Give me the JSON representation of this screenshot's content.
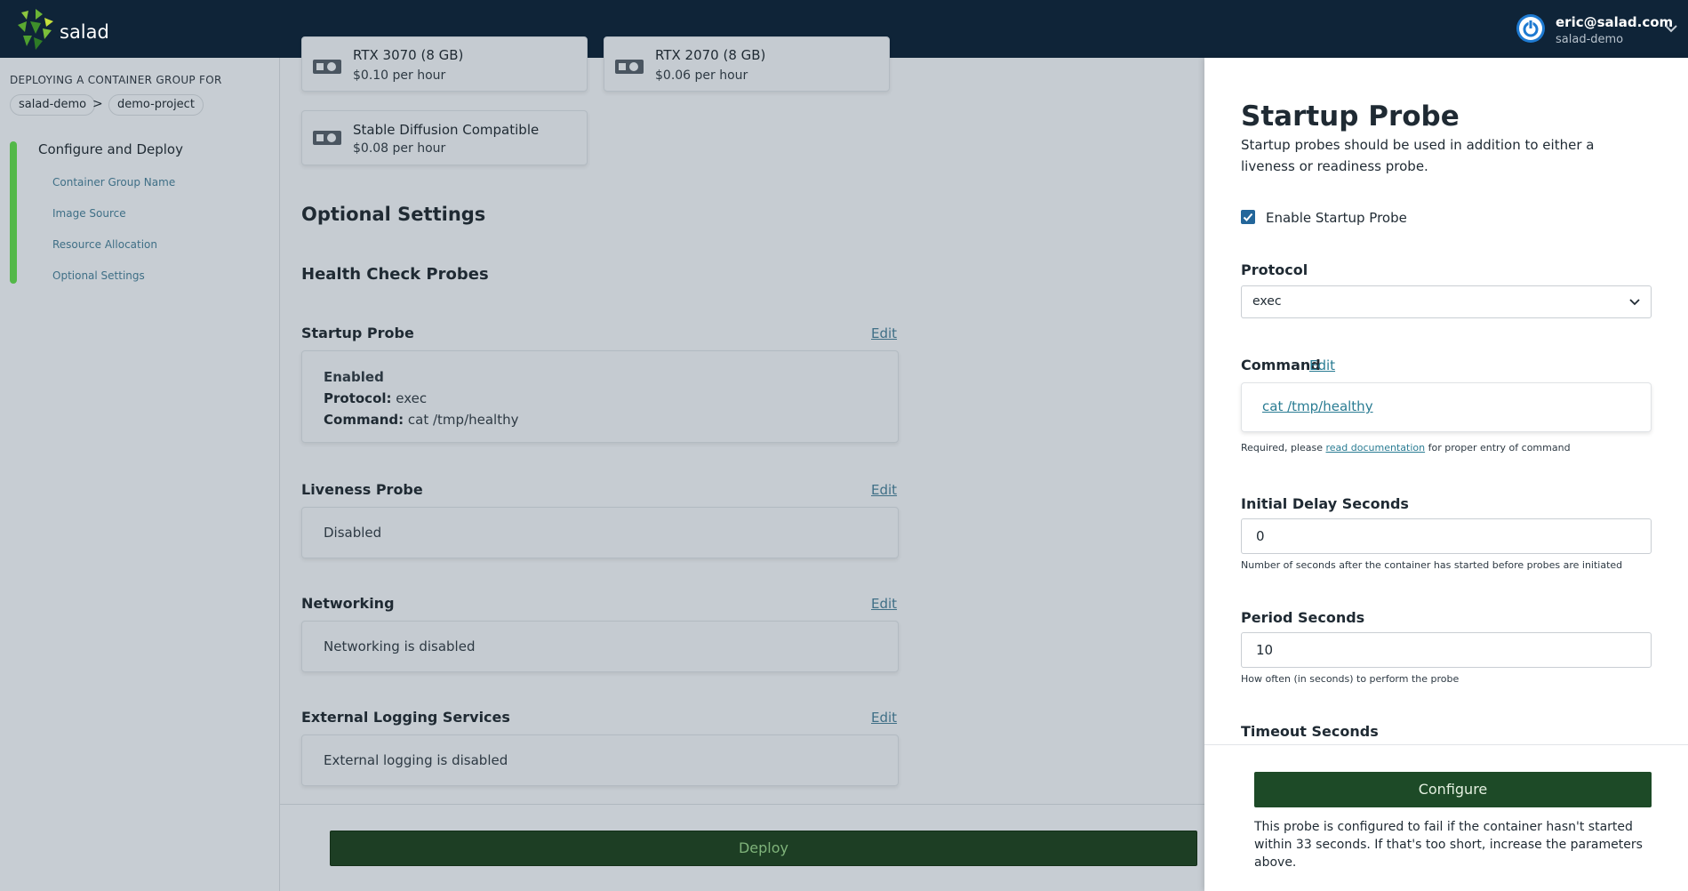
{
  "header": {
    "brand": "salad",
    "user_email": "eric@salad.com",
    "user_org": "salad-demo"
  },
  "sidebar": {
    "deploying_label": "DEPLOYING A CONTAINER GROUP FOR",
    "org_crumb": "salad-demo",
    "crumb_separator": ">",
    "project_crumb": "demo-project",
    "step_title": "Configure and Deploy",
    "steps": [
      "Container Group Name",
      "Image Source",
      "Resource Allocation",
      "Optional Settings"
    ]
  },
  "gpus": [
    {
      "name": "RTX 3070 (8 GB)",
      "price": "$0.10 per hour"
    },
    {
      "name": "RTX 2070 (8 GB)",
      "price": "$0.06 per hour"
    },
    {
      "name": "Stable Diffusion Compatible",
      "price": "$0.08 per hour"
    }
  ],
  "main": {
    "optional_settings": "Optional Settings",
    "health_check_probes": "Health Check Probes",
    "edit_label": "Edit",
    "startup": {
      "title": "Startup Probe",
      "status": "Enabled",
      "protocol_label": "Protocol:",
      "protocol_value": "exec",
      "command_label": "Command:",
      "command_value": "cat /tmp/healthy"
    },
    "liveness": {
      "title": "Liveness Probe",
      "status": "Disabled"
    },
    "networking": {
      "title": "Networking",
      "status": "Networking is disabled"
    },
    "logging": {
      "title": "External Logging Services",
      "status": "External logging is disabled"
    },
    "deploy_label": "Deploy"
  },
  "panel": {
    "title": "Startup Probe",
    "description": "Startup probes should be used in addition to either a liveness or readiness probe.",
    "enable_label": "Enable Startup Probe",
    "enable_checked": true,
    "protocol_label": "Protocol",
    "protocol_value": "exec",
    "command_label": "Command",
    "command_edit": "Edit",
    "command_value": "cat /tmp/healthy",
    "command_help_pre": "Required, please",
    "command_help_link": "read documentation",
    "command_help_post": "for proper entry of command",
    "initial_delay_label": "Initial Delay Seconds",
    "initial_delay_value": "0",
    "initial_delay_help": "Number of seconds after the container has started before probes are initiated",
    "period_label": "Period Seconds",
    "period_value": "10",
    "period_help": "How often (in seconds) to perform the probe",
    "timeout_label": "Timeout Seconds",
    "configure_label": "Configure",
    "footer_note": "This probe is configured to fail if the container hasn't started within 33 seconds. If that's too short, increase the parameters above."
  },
  "colors": {
    "topbar": "#0f2438",
    "accent_green": "#53b848",
    "button_green": "#1d4a27",
    "link": "#2a7c93",
    "checkbox": "#23669a"
  },
  "icons": {
    "logo": "salad-logo-icon",
    "user": "power-icon",
    "caret": "chevron-down-icon",
    "gpu": "gpu-card-icon",
    "checkbox": "checkmark-icon"
  }
}
